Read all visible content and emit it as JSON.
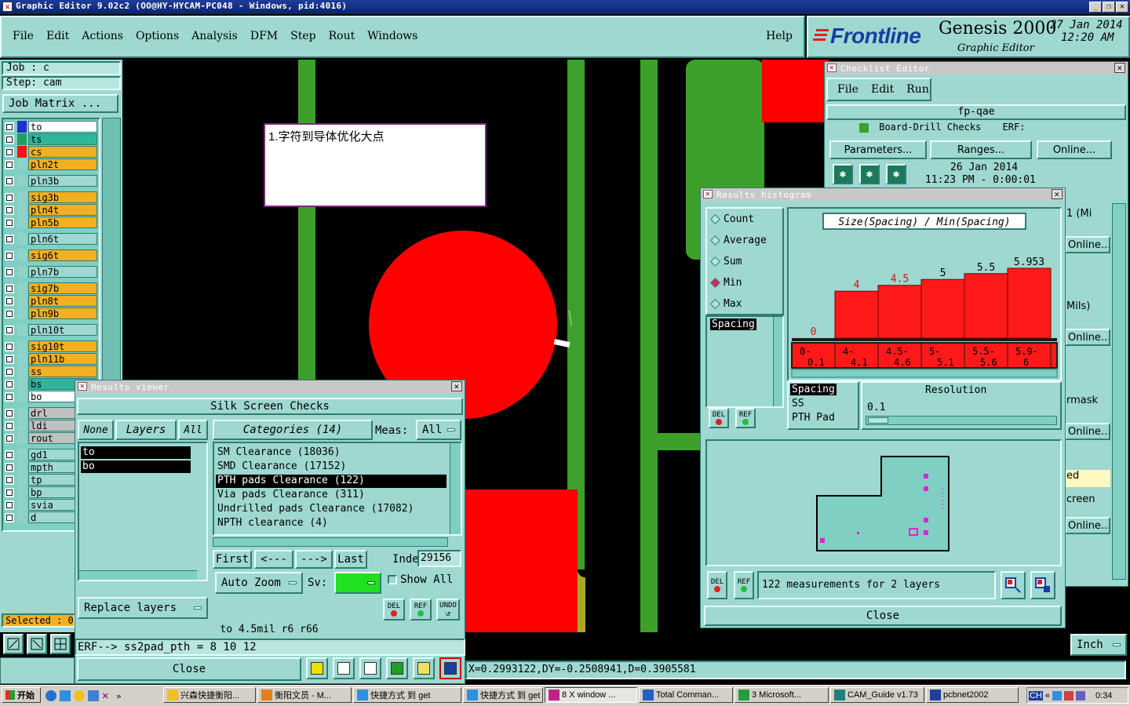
{
  "window": {
    "title": "Graphic Editor 9.02c2 (OO@HY-HYCAM-PC048 - Windows, pid:4016)"
  },
  "menu": {
    "items": [
      "File",
      "Edit",
      "Actions",
      "Options",
      "Analysis",
      "DFM",
      "Step",
      "Rout",
      "Windows"
    ],
    "help": "Help"
  },
  "brand": {
    "logo": "Frontline",
    "product": "Genesis 2000",
    "subtitle": "Graphic Editor",
    "date": "27 Jan 2014",
    "time": "12:20 AM"
  },
  "job": {
    "job_label": "Job  :  c",
    "step_label": "Step: cam",
    "matrix_button": "Job Matrix ..."
  },
  "layers": [
    {
      "name": "to",
      "color": "#ffffff"
    },
    {
      "name": "ts",
      "color": "#2fb59a"
    },
    {
      "name": "cs",
      "color": "#f2b020"
    },
    {
      "name": "pln2t",
      "color": "#f2b020"
    },
    {
      "name": "pln3b",
      "color": "#9ed8d0"
    },
    {
      "name": "sig3b",
      "color": "#f2b020"
    },
    {
      "name": "pln4t",
      "color": "#f2b020"
    },
    {
      "name": "pln5b",
      "color": "#f2b020"
    },
    {
      "name": "pln6t",
      "color": "#9ed8d0"
    },
    {
      "name": "sig6t",
      "color": "#f2b020"
    },
    {
      "name": "pln7b",
      "color": "#9ed8d0"
    },
    {
      "name": "sig7b",
      "color": "#f2b020"
    },
    {
      "name": "pln8t",
      "color": "#f2b020"
    },
    {
      "name": "pln9b",
      "color": "#f2b020"
    },
    {
      "name": "pln10t",
      "color": "#9ed8d0"
    },
    {
      "name": "sig10t",
      "color": "#f2b020"
    },
    {
      "name": "pln11b",
      "color": "#f2b020"
    },
    {
      "name": "ss",
      "color": "#f2b020"
    },
    {
      "name": "bs",
      "color": "#2fb59a"
    },
    {
      "name": "bo",
      "color": "#ffffff"
    },
    {
      "name": "drl",
      "color": "#c0c0c0"
    },
    {
      "name": "ldi",
      "color": "#c0c0c0"
    },
    {
      "name": "rout",
      "color": "#c0c0c0"
    },
    {
      "name": "gd1",
      "color": "#9ed8d0"
    },
    {
      "name": "mpth",
      "color": "#9ed8d0"
    },
    {
      "name": "tp",
      "color": "#9ed8d0"
    },
    {
      "name": "bp",
      "color": "#9ed8d0"
    },
    {
      "name": "svia",
      "color": "#9ed8d0"
    },
    {
      "name": "d",
      "color": "#9ed8d0"
    }
  ],
  "selected_label": "Selected : 0",
  "annotation": {
    "text": "1.字符到导体优化大点"
  },
  "checklist": {
    "title": "Checklist Editor",
    "menu": [
      "File",
      "Edit",
      "Run"
    ],
    "name": "fp-qae",
    "row_text": "Board-Drill Checks",
    "row_erf": "ERF:",
    "buttons": [
      "Parameters...",
      "Ranges...",
      "Online..."
    ],
    "date": "26 Jan 2014",
    "time": "11:23 PM - 0:00:01",
    "side_labels": [
      "1 (Mi",
      "Online...",
      "Mils)",
      "Online...",
      "rmask",
      "Online...",
      "ed",
      "creen",
      "Online..."
    ]
  },
  "histogram": {
    "title": "Results histogram",
    "modes": [
      "Count",
      "Average",
      "Sum",
      "Min",
      "Max"
    ],
    "selected_mode": "Min",
    "chart_title": "Size(Spacing) / Min(Spacing)",
    "list_selected": "Spacing",
    "types": [
      "Spacing",
      "SS",
      "PTH Pad"
    ],
    "resolution_label": "Resolution",
    "resolution_value": "0.1",
    "measurements": "122 measurements for 2 layers",
    "del": "DEL",
    "ref": "REF",
    "close": "Close"
  },
  "chart_data": {
    "type": "bar",
    "title": "Size(Spacing) / Min(Spacing)",
    "categories": [
      "0-0.1",
      "4-4.1",
      "4.5-4.6",
      "5-5.1",
      "5.5-5.6",
      "5.9-6"
    ],
    "values": [
      0,
      4,
      4.5,
      5,
      5.5,
      5.953
    ],
    "value_labels": [
      "0",
      "4",
      "4.5",
      "5",
      "5.5",
      "5.953"
    ],
    "tick_lines": [
      [
        "0-",
        "0.1"
      ],
      [
        "4-",
        "4.1"
      ],
      [
        "4.5-",
        "4.6"
      ],
      [
        "5-",
        "5.1"
      ],
      [
        "5.5-",
        "5.6"
      ],
      [
        "5.9-",
        "6"
      ]
    ],
    "ylim": [
      0,
      7
    ],
    "color": "#ff1a1a"
  },
  "results": {
    "title": "Results viewer",
    "header": "Silk Screen Checks",
    "none": "None",
    "layers_btn": "Layers",
    "all": "All",
    "layer_items": [
      "to",
      "bo"
    ],
    "categories_btn": "Categories (14)",
    "meas_label": "Meas:",
    "meas_value": "All",
    "categories": [
      "SM Clearance (18036)",
      "SMD Clearance (17152)",
      "PTH pads Clearance (122)",
      "Via pads Clearance (311)",
      "Undrilled pads Clearance (17082)",
      "NPTH clearance (4)"
    ],
    "selected_category": 2,
    "nav": [
      "First",
      "<---",
      "--->",
      "Last"
    ],
    "index_label": "Index:",
    "index_value": "29156",
    "auto_zoom": "Auto Zoom",
    "sv_label": "Sv:",
    "show_all": "Show All",
    "replace_layers": "Replace layers",
    "del": "DEL",
    "ref": "REF",
    "undo": "UNDO",
    "status": "to 4.5mil  r6  r66",
    "close": "Close"
  },
  "erf_line": "ERF--> ss2pad_pth = 8 10 12",
  "coords": "X=0.2993122,DY=-0.2508941,D=0.3905581",
  "units": "Inch",
  "taskbar": {
    "start": "开始",
    "items": [
      "兴森快捷衡阳...",
      "衡阳文员 - M...",
      "快捷方式 到 get",
      "快捷方式 到 get",
      "8 X window ...",
      "Total Comman...",
      "3 Microsoft...",
      "CAM_Guide v1.73",
      "pcbnet2002"
    ],
    "tray_lang": "CH",
    "clock": "0:34"
  }
}
